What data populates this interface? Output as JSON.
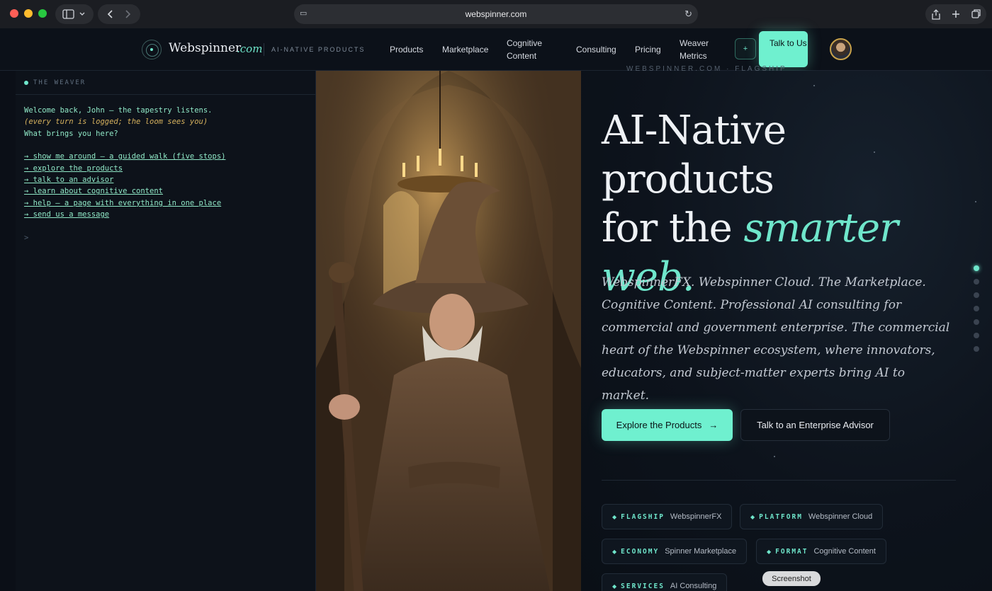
{
  "browser": {
    "url": "webspinner.com",
    "traffic_colors": [
      "#ff5f57",
      "#febc2e",
      "#28c840"
    ]
  },
  "nav": {
    "logo_name": "Webspinner",
    "logo_tld": ".com",
    "tagline": "AI-NATIVE PRODUCTS",
    "links": [
      "Products",
      "Marketplace",
      "Cognitive Content",
      "Consulting",
      "Pricing",
      "Weaver Metrics"
    ],
    "plus_label": "+",
    "cta_label": "Talk to Us"
  },
  "terminal": {
    "title": "THE WEAVER",
    "greeting": "Welcome back, John — the tapestry listens.",
    "note": "(every turn is logged; the loom sees you)",
    "question": "What brings you here?",
    "options": [
      "→ show me around — a guided walk (five stops)",
      "→ explore the products",
      "→ talk to an advisor",
      "→ learn about cognitive content",
      "→ help — a page with everything in one place",
      "→ send us a message"
    ],
    "prompt": ">"
  },
  "hero": {
    "eyebrow": "WEBSPINNER.COM · FLAGSHIP",
    "title_line1": "AI-Native",
    "title_line2": "products",
    "title_line3_plain": "for the ",
    "title_line3_accent": "smarter web.",
    "subtitle": "WebspinnerFX. Webspinner Cloud. The Marketplace. Cognitive Content. Professional AI consulting for commercial and government enterprise. The commercial heart of the Webspinner ecosystem, where innovators, educators, and subject-matter experts bring AI to market.",
    "primary_cta": "Explore the Products",
    "primary_arrow": "→",
    "secondary_cta": "Talk to an Enterprise Advisor",
    "chips": [
      {
        "kind": "FLAGSHIP",
        "name": "WebspinnerFX"
      },
      {
        "kind": "PLATFORM",
        "name": "Webspinner Cloud"
      },
      {
        "kind": "ECONOMY",
        "name": "Spinner Marketplace"
      },
      {
        "kind": "FORMAT",
        "name": "Cognitive Content"
      },
      {
        "kind": "SERVICES",
        "name": "AI Consulting"
      }
    ],
    "chip_marker": "◆"
  },
  "tooltip": "Screenshot",
  "accent_color": "#6fe6cb"
}
